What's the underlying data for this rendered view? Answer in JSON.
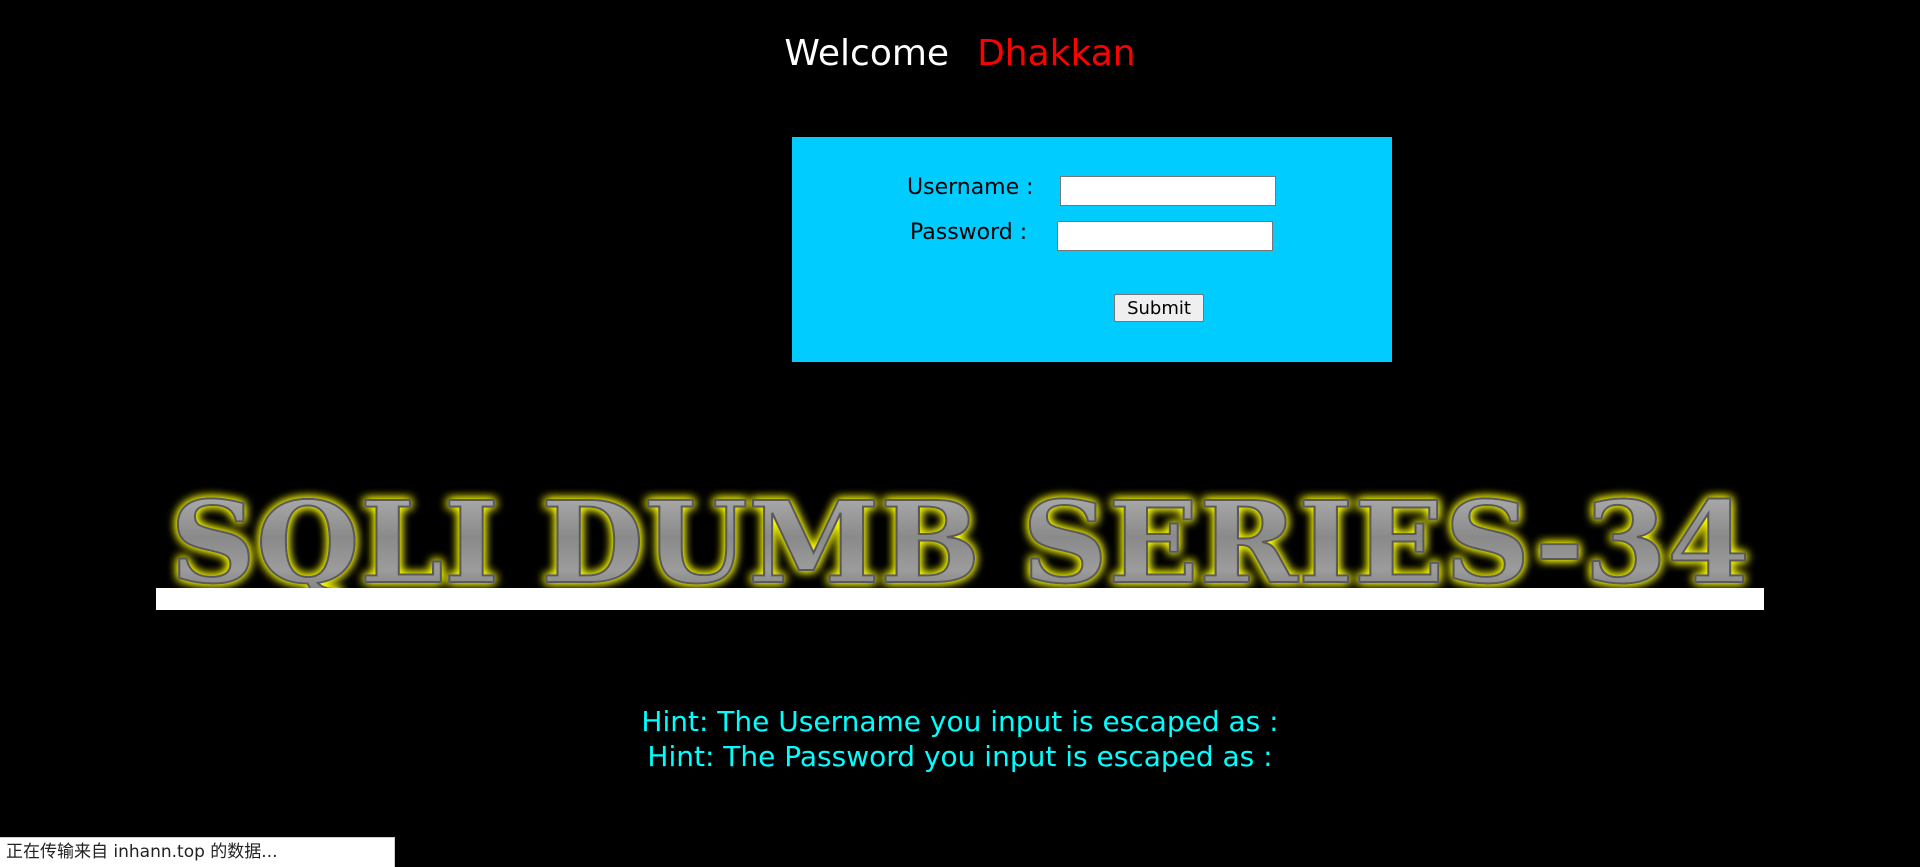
{
  "welcome": {
    "greeting": "Welcome",
    "name": "Dhakkan"
  },
  "login": {
    "username_label": "Username :",
    "password_label": "Password :",
    "username_value": "",
    "password_value": "",
    "submit_label": "Submit"
  },
  "banner": {
    "text": "SQLI DUMB SERIES-34"
  },
  "hints": {
    "username": "Hint: The Username you input is escaped as :",
    "password": "Hint: The Password you input is escaped as :"
  },
  "statusbar": {
    "text": "正在传输来自 inhann.top 的数据..."
  },
  "colors": {
    "background": "#000000",
    "login_box": "#00ccff",
    "welcome_name": "#ff0000",
    "hint_text": "#00ffff",
    "banner_glow": "#ffff00"
  }
}
